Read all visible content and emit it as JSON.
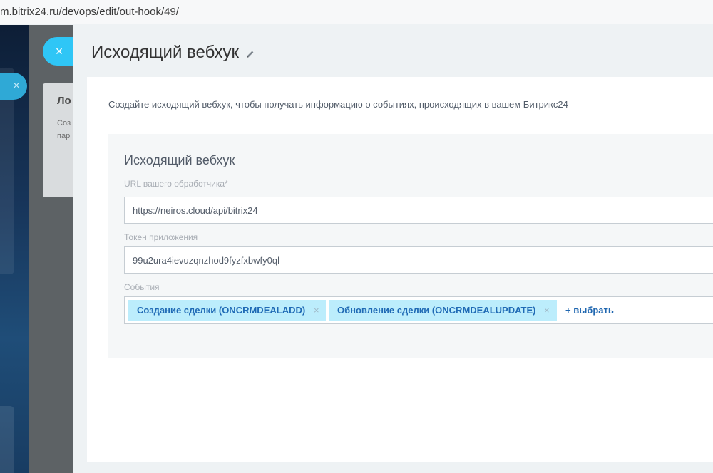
{
  "browser": {
    "url": "m.bitrix24.ru/devops/edit/out-hook/49/"
  },
  "background": {
    "close_symbol": "×",
    "card_title": "Ло",
    "card_line1": "Соз",
    "card_line2": "пар"
  },
  "slider": {
    "close_symbol": "×",
    "title": "Исходящий вебхук",
    "intro": "Создайте исходящий вебхук, чтобы получать информацию о событиях, происходящих в вашем Битрикс24",
    "form": {
      "title": "Исходящий вебхук",
      "url_label": "URL вашего обработчика*",
      "url_value": "https://neiros.cloud/api/bitrix24",
      "token_label": "Токен приложения",
      "token_value": "99u2ura4ievuzqnzhod9fyzfxbwfy0ql",
      "events_label": "События",
      "events": [
        {
          "label": "Создание сделки (ONCRMDEALADD)",
          "remove": "×"
        },
        {
          "label": "Обновление сделки (ONCRMDEALUPDATE)",
          "remove": "×"
        }
      ],
      "add_label": "+ выбрать"
    }
  },
  "colors": {
    "accent": "#2fc6f6",
    "tag_bg": "#bcedfc",
    "tag_text": "#1f6ab5",
    "link": "#2067b0"
  },
  "icons": [
    "close-icon",
    "pencil-icon",
    "tag-remove-icon"
  ]
}
